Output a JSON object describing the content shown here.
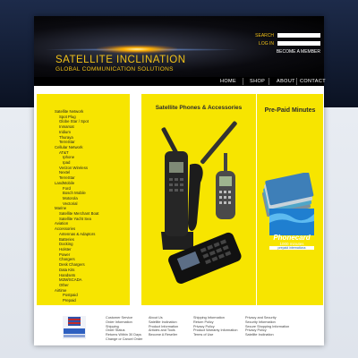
{
  "header": {
    "logo_title": "SATELLITE INCLINATION",
    "logo_subtitle": "GLOBAL COMMUNICATION SOLUTIONS",
    "search_label": "SEARCH",
    "login_label": "LOG IN",
    "become_member": "BECOME A MEMBER"
  },
  "nav": {
    "items": [
      "HOME",
      "SHOP",
      "ABOUT",
      "CONTACT"
    ]
  },
  "categories": [
    {
      "label": "Satellite Network",
      "level": 1
    },
    {
      "label": "Spot Plug",
      "level": 2
    },
    {
      "label": "Globe Star / Spot",
      "level": 2
    },
    {
      "label": "Inmarsat",
      "level": 2
    },
    {
      "label": "Iridium",
      "level": 2
    },
    {
      "label": "Thuraya",
      "level": 2
    },
    {
      "label": "TerreStar",
      "level": 2
    },
    {
      "label": "Cellular Network",
      "level": 1
    },
    {
      "label": "AT&T",
      "level": 2
    },
    {
      "label": "Iphone",
      "level": 3
    },
    {
      "label": "Ipad",
      "level": 3
    },
    {
      "label": "Verizon Wireless",
      "level": 2
    },
    {
      "label": "Nextel",
      "level": 2
    },
    {
      "label": "TerreStar",
      "level": 2
    },
    {
      "label": "LandMobile",
      "level": 1
    },
    {
      "label": "Ford",
      "level": 3
    },
    {
      "label": "Bosch Mobile",
      "level": 3
    },
    {
      "label": "Motorola",
      "level": 3
    },
    {
      "label": "Vectorial",
      "level": 3
    },
    {
      "label": "Marine",
      "level": 1
    },
    {
      "label": "Satellite Merchant Boat",
      "level": 2
    },
    {
      "label": "Satellite Yacht Sea",
      "level": 2
    },
    {
      "label": "Aviation",
      "level": 1
    },
    {
      "label": "Accessories",
      "level": 1
    },
    {
      "label": "Antennas & Adaptors",
      "level": 2
    },
    {
      "label": "Batteries",
      "level": 2
    },
    {
      "label": "Docking",
      "level": 2
    },
    {
      "label": "Holster",
      "level": 2
    },
    {
      "label": "Power",
      "level": 2
    },
    {
      "label": "Chargers",
      "level": 2
    },
    {
      "label": "Desk Chargers",
      "level": 2
    },
    {
      "label": "Data Kits",
      "level": 2
    },
    {
      "label": "Handsets",
      "level": 2
    },
    {
      "label": "M2M/SCADA",
      "level": 2
    },
    {
      "label": "Other",
      "level": 2
    },
    {
      "label": "Airtime",
      "level": 1
    },
    {
      "label": "Postpaid",
      "level": 3
    },
    {
      "label": "Prepaid",
      "level": 3
    }
  ],
  "panels": {
    "phones_title": "Satellite Phones & Accessories",
    "minutes_title": "Pre-Paid Minutes",
    "phonecard_label": "Phonecard",
    "phonecard_minutes": "1000 minutes",
    "phonecard_tagline": "prepaid internationa"
  },
  "footer": {
    "columns": [
      [
        "Customer Service",
        "Order Information",
        "Shipping",
        "Order Status",
        "Returns Within 30 Days",
        "Change or Cancel Order"
      ],
      [
        "About Us",
        "Satellite Inclination",
        "Product Information",
        "Articles and Tools",
        "Become A Reseller"
      ],
      [
        "Shipping Information",
        "Return Policy",
        "Privacy Policy",
        "Product Warranty Information",
        "Terms of Use"
      ],
      [
        "Privacy and Security",
        "Security Information",
        "Secure Shopping Information",
        "Privacy Policy",
        "Satellite Inclination"
      ]
    ]
  },
  "colors": {
    "accent_yellow": "#f7e500",
    "logo_gold": "#f2c218",
    "header_black": "#000000"
  }
}
